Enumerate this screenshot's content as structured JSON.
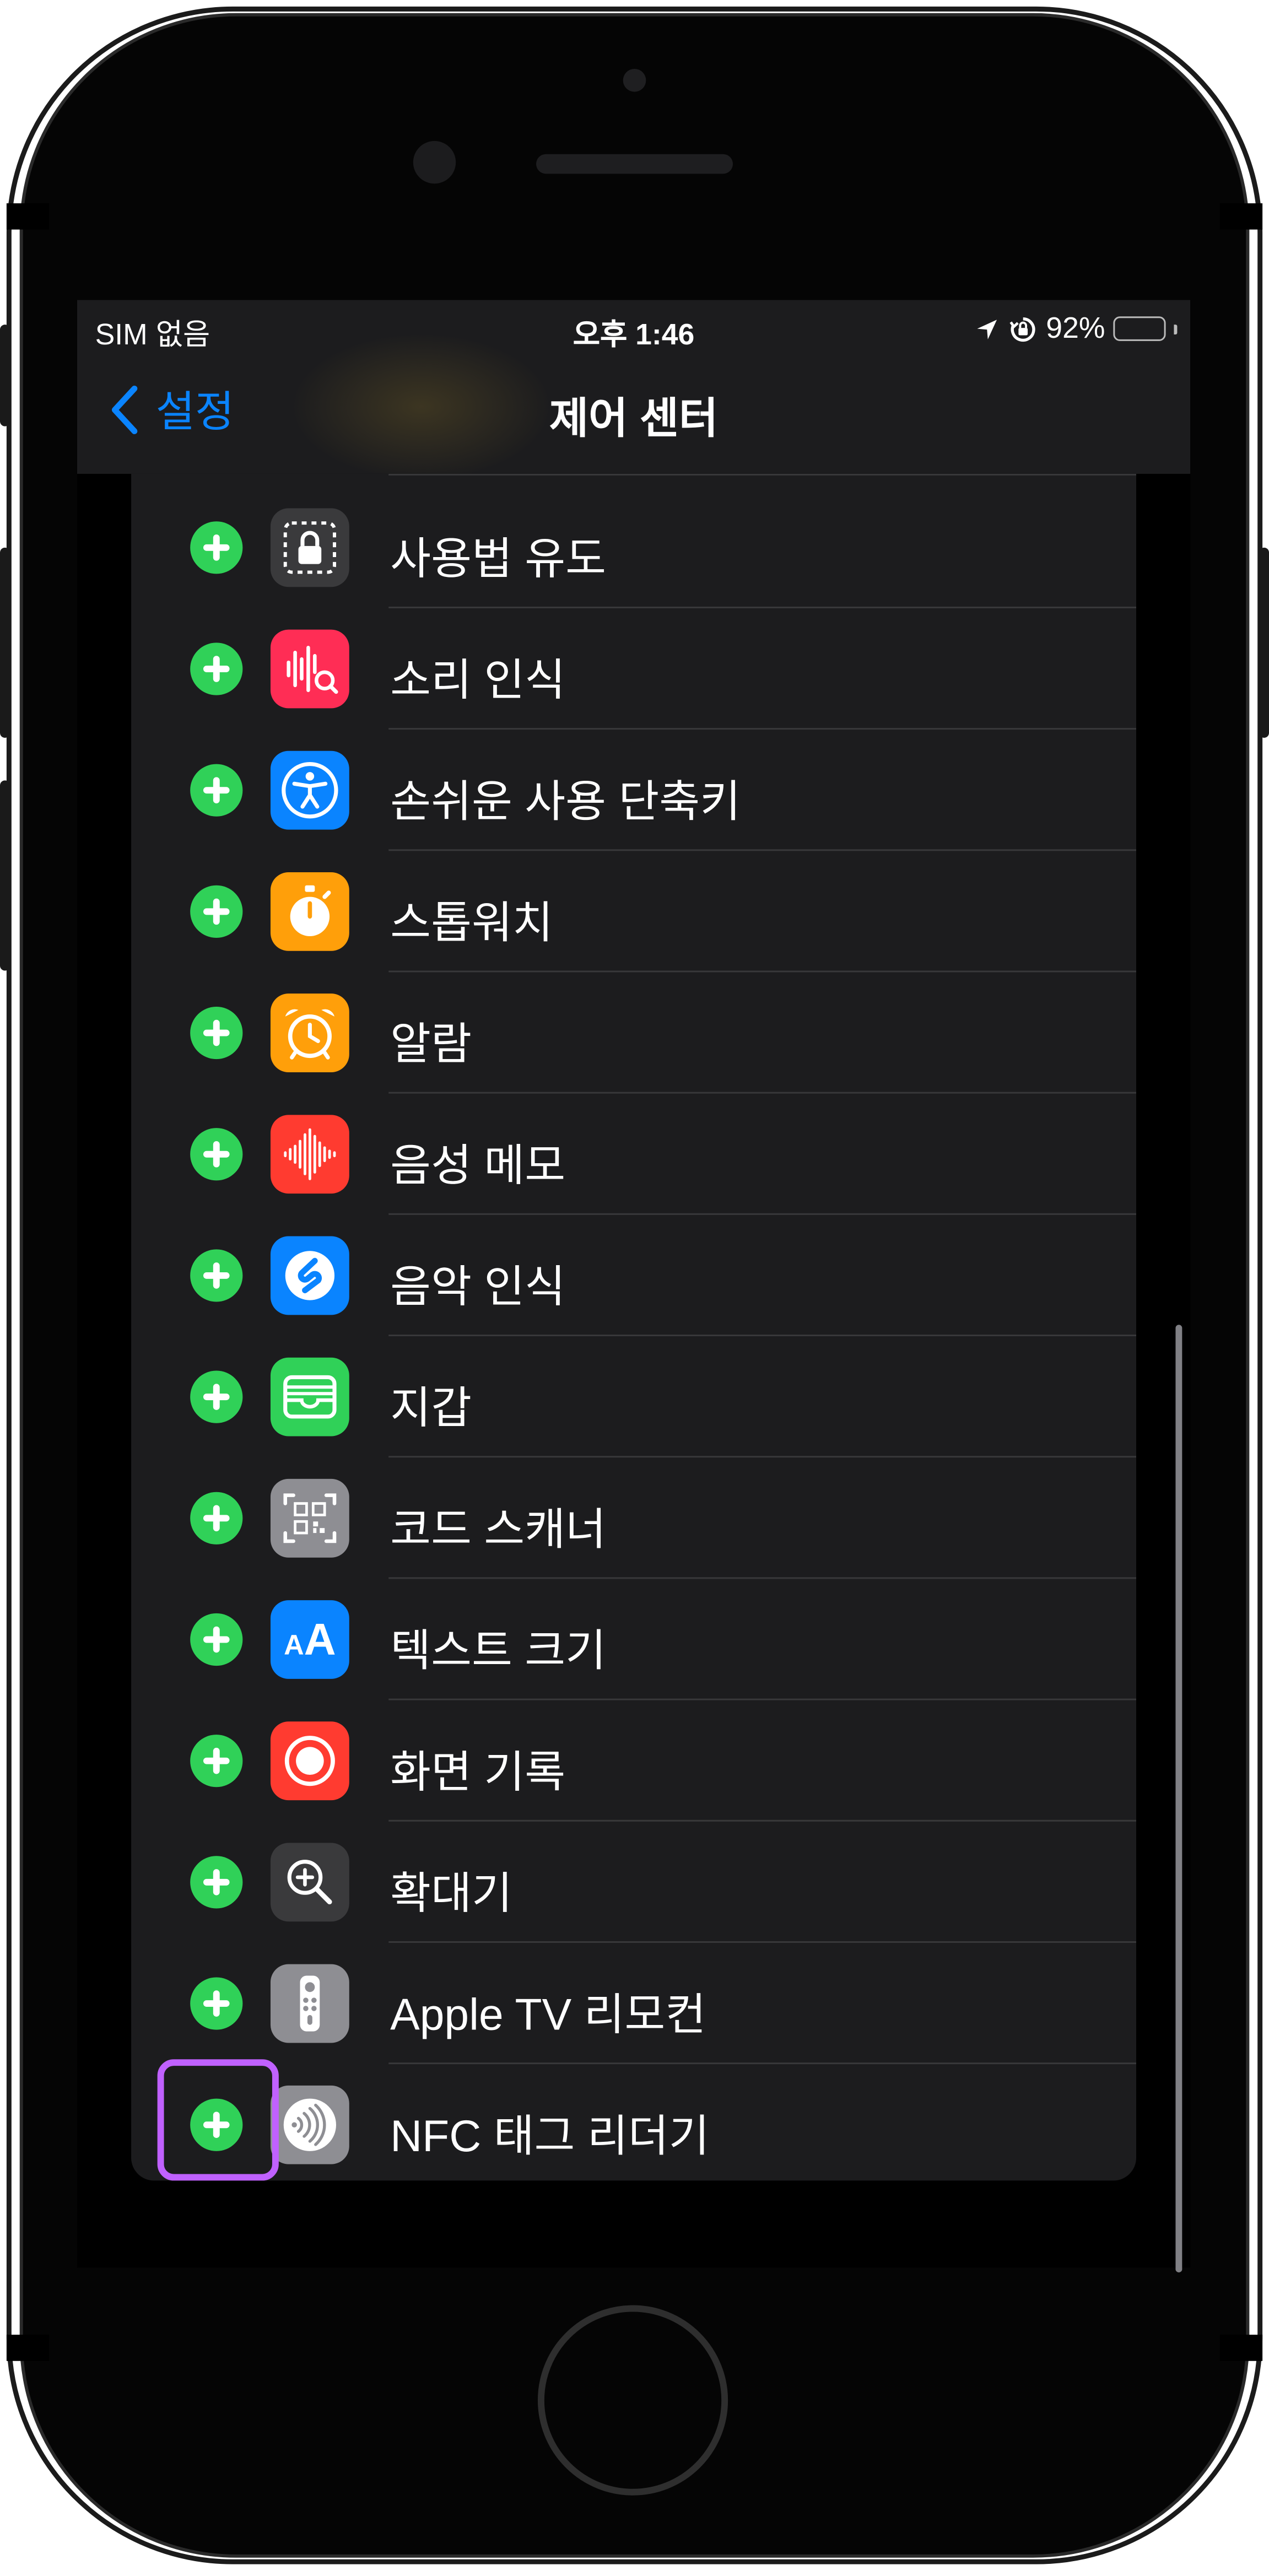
{
  "status_bar": {
    "carrier": "SIM 없음",
    "time": "오후 1:46",
    "battery": "92%"
  },
  "nav": {
    "back_label": "설정",
    "title": "제어 센터"
  },
  "items": [
    {
      "label": "사용법 유도",
      "icon": "lock-icon",
      "color": "#3a3a3c"
    },
    {
      "label": "소리 인식",
      "icon": "sound-recognition-icon",
      "color": "#ff2d55"
    },
    {
      "label": "손쉬운 사용 단축키",
      "icon": "accessibility-icon",
      "color": "#0a84ff"
    },
    {
      "label": "스톱워치",
      "icon": "stopwatch-icon",
      "color": "#ff9f0a"
    },
    {
      "label": "알람",
      "icon": "alarm-clock-icon",
      "color": "#ff9f0a"
    },
    {
      "label": "음성 메모",
      "icon": "waveform-icon",
      "color": "#ff3b30"
    },
    {
      "label": "음악 인식",
      "icon": "shazam-icon",
      "color": "#0a84ff"
    },
    {
      "label": "지갑",
      "icon": "wallet-icon",
      "color": "#30d158"
    },
    {
      "label": "코드 스캐너",
      "icon": "qr-code-icon",
      "color": "#8e8e93"
    },
    {
      "label": "텍스트 크기",
      "icon": "text-size-icon",
      "color": "#0a84ff",
      "icon_text": "AA"
    },
    {
      "label": "화면 기록",
      "icon": "screen-record-icon",
      "color": "#ff3b30"
    },
    {
      "label": "확대기",
      "icon": "magnifier-icon",
      "color": "#3a3a3c"
    },
    {
      "label": "Apple TV 리모컨",
      "icon": "tv-remote-icon",
      "color": "#8e8e93"
    },
    {
      "label": "NFC 태그 리더기",
      "icon": "nfc-icon",
      "color": "#8e8e93"
    }
  ],
  "colors": {
    "accent": "#0a84ff",
    "add_button": "#30d158",
    "highlight": "#c061ff"
  }
}
